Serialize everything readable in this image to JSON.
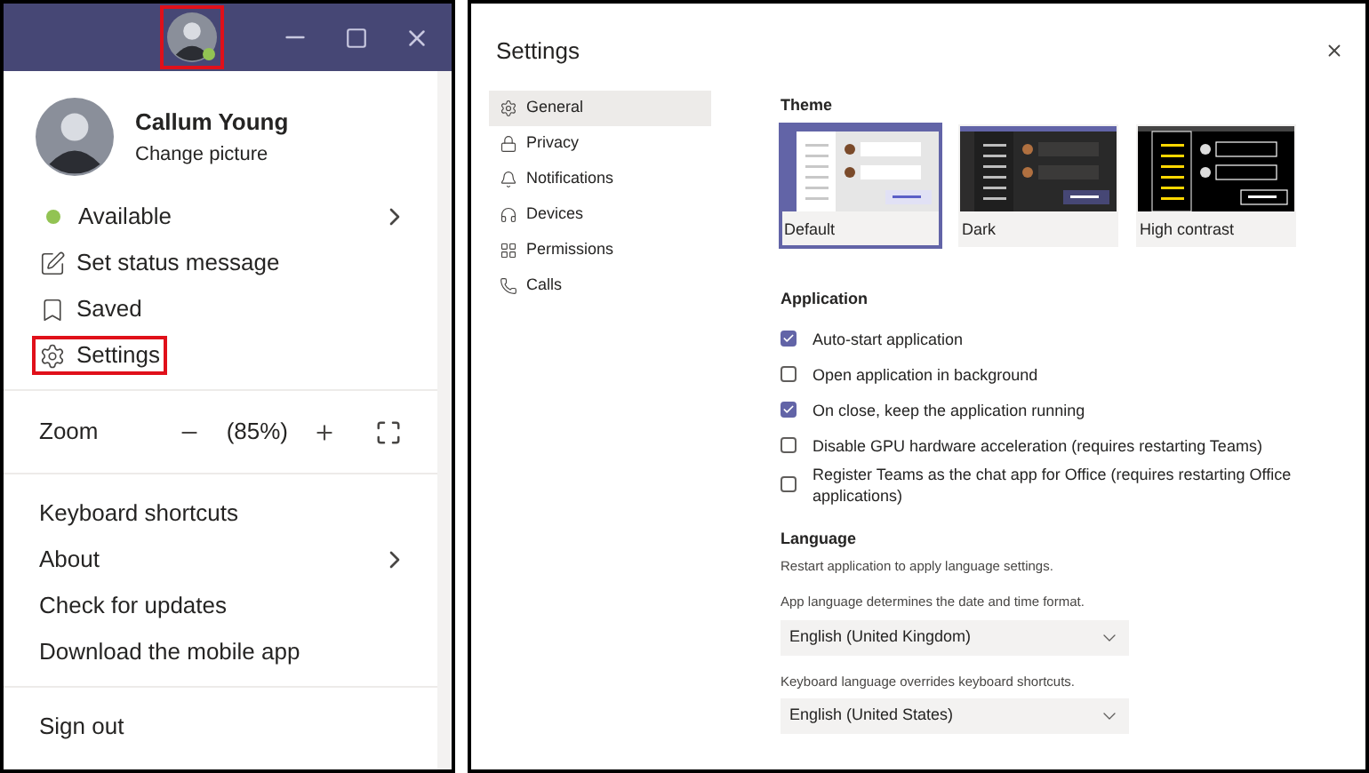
{
  "titlebar": {
    "avatar_highlighted": true
  },
  "profile": {
    "name": "Callum Young",
    "action": "Change picture"
  },
  "status_section": [
    {
      "label": "Available",
      "kind": "status",
      "color": "#92c353",
      "submenu": true,
      "highlighted": false
    },
    {
      "label": "Set status message",
      "kind": "item",
      "submenu": false,
      "highlighted": false
    },
    {
      "label": "Saved",
      "kind": "item",
      "submenu": false,
      "highlighted": false
    },
    {
      "label": "Settings",
      "kind": "item",
      "submenu": false,
      "highlighted": true
    }
  ],
  "zoom": {
    "label": "Zoom",
    "value": "(85%)"
  },
  "help_section": [
    {
      "label": "Keyboard shortcuts",
      "submenu": false
    },
    {
      "label": "About",
      "submenu": true
    },
    {
      "label": "Check for updates",
      "submenu": false
    },
    {
      "label": "Download the mobile app",
      "submenu": false
    }
  ],
  "sign_out": "Sign out",
  "settings": {
    "title": "Settings",
    "nav": [
      {
        "label": "General",
        "selected": true
      },
      {
        "label": "Privacy",
        "selected": false
      },
      {
        "label": "Notifications",
        "selected": false
      },
      {
        "label": "Devices",
        "selected": false
      },
      {
        "label": "Permissions",
        "selected": false
      },
      {
        "label": "Calls",
        "selected": false
      }
    ],
    "theme": {
      "heading": "Theme",
      "options": [
        {
          "label": "Default",
          "kind": "default",
          "selected": true
        },
        {
          "label": "Dark",
          "kind": "dark",
          "selected": false
        },
        {
          "label": "High contrast",
          "kind": "contrast",
          "selected": false
        }
      ]
    },
    "application": {
      "heading": "Application",
      "options": [
        {
          "label": "Auto-start application",
          "checked": true
        },
        {
          "label": "Open application in background",
          "checked": false
        },
        {
          "label": "On close, keep the application running",
          "checked": true
        },
        {
          "label": "Disable GPU hardware acceleration (requires restarting Teams)",
          "checked": false
        },
        {
          "label": "Register Teams as the chat app for Office (requires restarting Office applications)",
          "checked": false
        }
      ]
    },
    "language": {
      "heading": "Language",
      "note": "Restart application to apply language settings.",
      "fields": [
        {
          "hint": "App language determines the date and time format.",
          "value": "English (United Kingdom)"
        },
        {
          "hint": "Keyboard language overrides keyboard shortcuts.",
          "value": "English (United States)"
        }
      ]
    }
  }
}
